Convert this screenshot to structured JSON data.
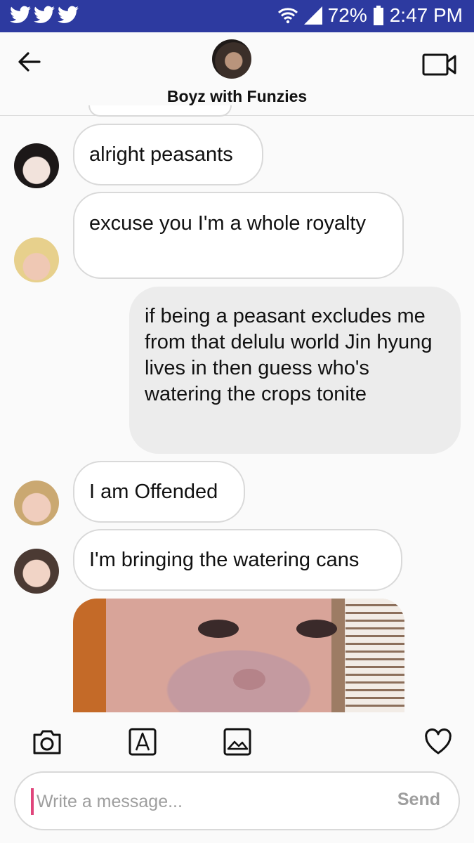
{
  "status_bar": {
    "battery": "72%",
    "time": "2:47 PM",
    "notification_icons": [
      "twitter-icon",
      "twitter-icon",
      "twitter-icon"
    ]
  },
  "header": {
    "title": "Boyz with Funzies",
    "icons": [
      "back-arrow-icon",
      "video-call-icon"
    ]
  },
  "messages": [
    {
      "direction": "incoming",
      "text": "alright peasants"
    },
    {
      "direction": "incoming",
      "text": "excuse you I'm a whole royalty"
    },
    {
      "direction": "outgoing",
      "text": "if being a peasant excludes me from that delulu world Jin hyung lives in then guess who's watering the crops tonite"
    },
    {
      "direction": "incoming",
      "text": "I am Offended"
    },
    {
      "direction": "incoming",
      "text": "I'm bringing the watering cans"
    },
    {
      "direction": "incoming",
      "type": "image"
    }
  ],
  "toolbar": {
    "icons": [
      "camera-icon",
      "text-format-icon",
      "gallery-icon",
      "heart-icon"
    ]
  },
  "composer": {
    "placeholder": "Write a message...",
    "value": "",
    "send_label": "Send"
  },
  "colors": {
    "status_bar": "#2d3aa0",
    "incoming_bubble": "#ffffff",
    "outgoing_bubble": "#ececec",
    "cursor": "#e0457b"
  }
}
